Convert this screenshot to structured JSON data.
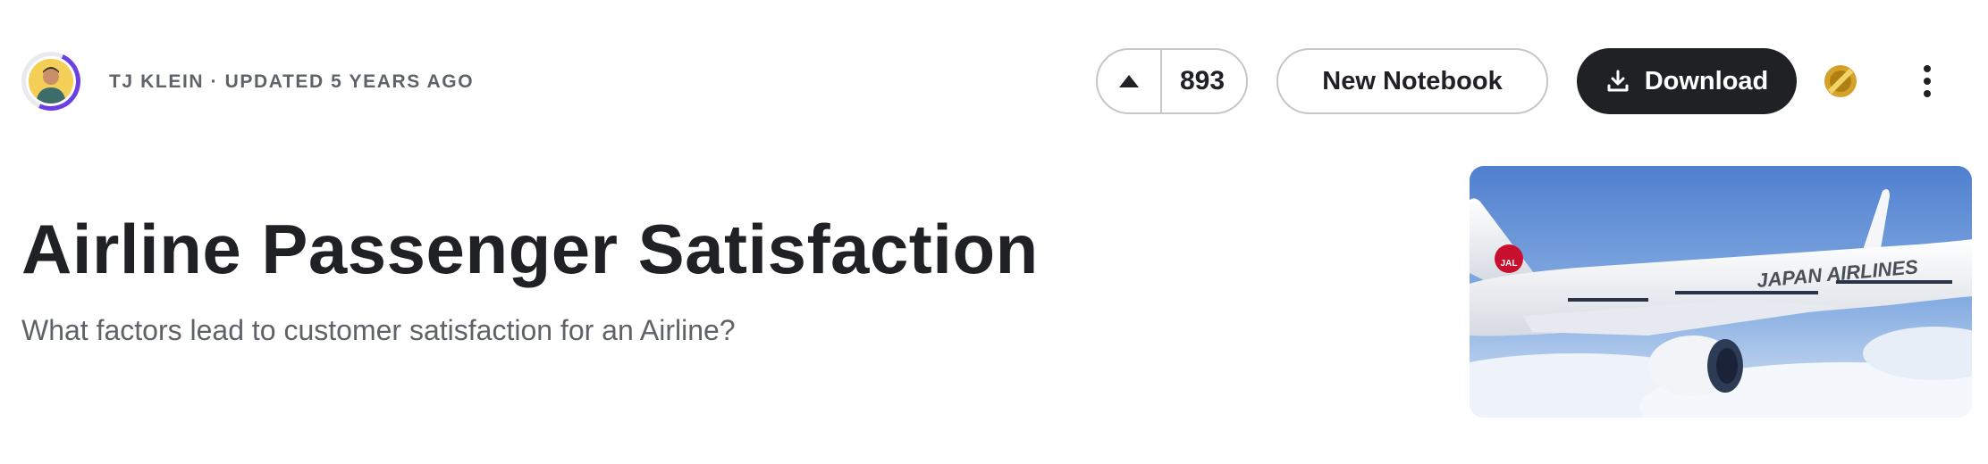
{
  "author": {
    "line": "TJ KLEIN · UPDATED 5 YEARS AGO"
  },
  "actions": {
    "vote_count": "893",
    "new_notebook_label": "New Notebook",
    "download_label": "Download"
  },
  "dataset": {
    "title": "Airline Passenger Satisfaction",
    "subtitle": "What factors lead to customer satisfaction for an Airline?"
  },
  "cover_image": {
    "tail_logo_text": "JAL",
    "fuselage_text": "JAPAN AIRLINES"
  },
  "icons": {
    "vote": "triangle-up-icon",
    "download": "download-icon",
    "medal": "bronze-medal-icon",
    "more": "more-vertical-icon"
  },
  "colors": {
    "primary_dark": "#202124",
    "muted_text": "#5f6368",
    "avatar_ring": "#6c3fe3",
    "medal": "#d4a229"
  }
}
